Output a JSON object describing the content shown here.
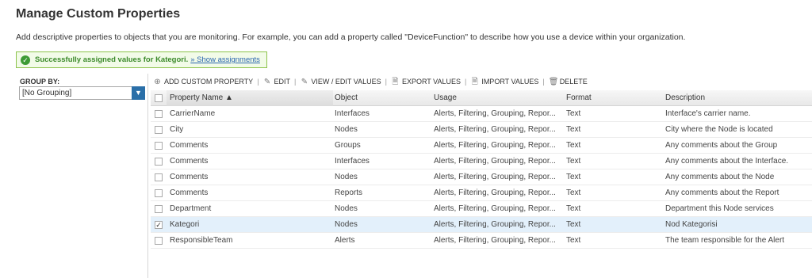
{
  "page": {
    "title": "Manage Custom Properties",
    "subtitle": "Add descriptive properties to objects that you are monitoring. For example, you can add a property called \"DeviceFunction\" to describe how you use a device within your organization."
  },
  "notice": {
    "message": "Successfully assigned values for Kategori.",
    "link": "» Show assignments"
  },
  "groupby": {
    "label": "GROUP BY:",
    "selected": "[No Grouping]"
  },
  "toolbar": {
    "add": "ADD CUSTOM PROPERTY",
    "edit": "EDIT",
    "view_edit": "VIEW / EDIT VALUES",
    "export": "EXPORT VALUES",
    "import": "IMPORT VALUES",
    "delete": "DELETE"
  },
  "grid": {
    "columns": {
      "name": "Property Name ▲",
      "object": "Object",
      "usage": "Usage",
      "format": "Format",
      "description": "Description"
    },
    "rows": [
      {
        "name": "CarrierName",
        "object": "Interfaces",
        "usage": "Alerts, Filtering, Grouping, Repor...",
        "format": "Text",
        "description": "Interface's carrier name.",
        "checked": false
      },
      {
        "name": "City",
        "object": "Nodes",
        "usage": "Alerts, Filtering, Grouping, Repor...",
        "format": "Text",
        "description": "City where the Node is located",
        "checked": false
      },
      {
        "name": "Comments",
        "object": "Groups",
        "usage": "Alerts, Filtering, Grouping, Repor...",
        "format": "Text",
        "description": "Any comments about the Group",
        "checked": false
      },
      {
        "name": "Comments",
        "object": "Interfaces",
        "usage": "Alerts, Filtering, Grouping, Repor...",
        "format": "Text",
        "description": "Any comments about the Interface.",
        "checked": false
      },
      {
        "name": "Comments",
        "object": "Nodes",
        "usage": "Alerts, Filtering, Grouping, Repor...",
        "format": "Text",
        "description": "Any comments about the Node",
        "checked": false
      },
      {
        "name": "Comments",
        "object": "Reports",
        "usage": "Alerts, Filtering, Grouping, Repor...",
        "format": "Text",
        "description": "Any comments about the Report",
        "checked": false
      },
      {
        "name": "Department",
        "object": "Nodes",
        "usage": "Alerts, Filtering, Grouping, Repor...",
        "format": "Text",
        "description": "Department this Node services",
        "checked": false
      },
      {
        "name": "Kategori",
        "object": "Nodes",
        "usage": "Alerts, Filtering, Grouping, Repor...",
        "format": "Text",
        "description": "Nod Kategorisi",
        "checked": true
      },
      {
        "name": "ResponsibleTeam",
        "object": "Alerts",
        "usage": "Alerts, Filtering, Grouping, Repor...",
        "format": "Text",
        "description": "The team responsible for the Alert",
        "checked": false
      }
    ]
  },
  "icons": {
    "success": "check-circle-icon",
    "add": "plus-circle-icon",
    "edit": "pencil-icon",
    "export": "document-export-icon",
    "import": "document-import-icon",
    "delete": "trash-icon",
    "dropdown": "chevron-down-icon"
  },
  "colors": {
    "success_bg": "#f2fbe8",
    "success_border": "#8cc34b",
    "success_text": "#3b8a2a",
    "link": "#2a66b0",
    "dropdown_accent": "#2a6fa8",
    "selected_row": "#e3f0fb"
  }
}
